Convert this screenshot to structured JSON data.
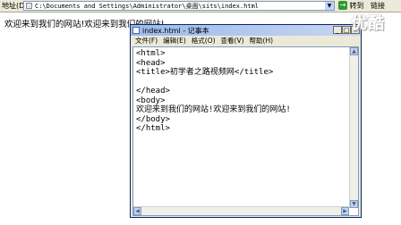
{
  "browser": {
    "address_label": "地址(D)",
    "address_value": "C:\\Documents and Settings\\Administrator\\桌面\\sits\\index.html",
    "go_label": "转到",
    "links_label": "链接"
  },
  "page": {
    "body_text": "欢迎来到我们的网站!欢迎来到我们的网站!"
  },
  "notepad": {
    "title": "index.html - 记事本",
    "menu": [
      "文件(F)",
      "编辑(E)",
      "格式(O)",
      "查看(V)",
      "帮助(H)"
    ],
    "lines": [
      "<html>",
      "<head>",
      "<title>初学者之路视频网</title>",
      "",
      "</head>",
      "<body>",
      "欢迎来到我们的网站!欢迎来到我们的网站!",
      "</body>",
      "</html>"
    ]
  },
  "watermark": "优酷",
  "colors": {
    "titlebar": "#9db9eb",
    "chrome": "#ece9d8",
    "go_arrow": "#2f9a2f"
  }
}
